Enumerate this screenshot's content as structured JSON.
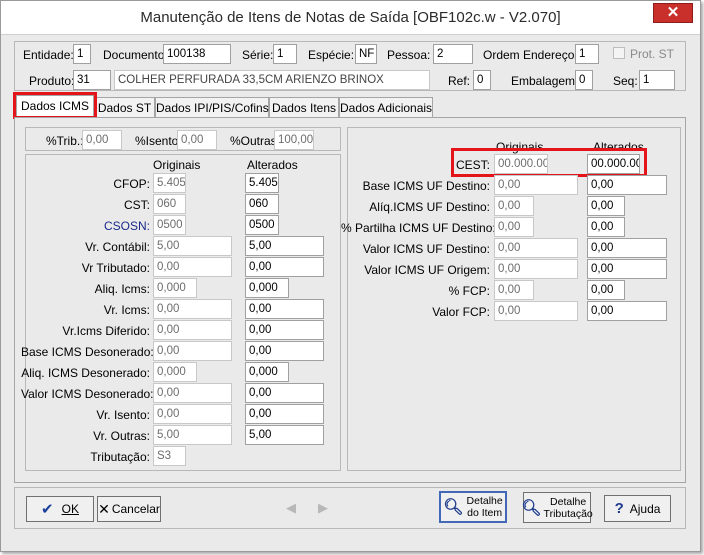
{
  "window": {
    "title": "Manutenção de Itens de Notas de Saída [OBF102c.w - V2.070]",
    "close": "✕"
  },
  "header": {
    "entidade_label": "Entidade:",
    "entidade": "1",
    "documento_label": "Documento:",
    "documento": "100138",
    "serie_label": "Série:",
    "serie": "1",
    "especie_label": "Espécie:",
    "especie": "NF",
    "pessoa_label": "Pessoa:",
    "pessoa": "2",
    "ordem_label": "Ordem Endereços:",
    "ordem": "1",
    "prot_label": "Prot. ST",
    "produto_label": "Produto:",
    "produto": "31",
    "produto_desc": "COLHER PERFURADA 33,5CM ARIENZO BRINOX",
    "ref_label": "Ref:",
    "ref": "0",
    "embalagem_label": "Embalagem:",
    "embalagem": "0",
    "seq_label": "Seq:",
    "seq": "1"
  },
  "tabs": [
    "Dados ICMS",
    "Dados ST",
    "Dados IPI/PIS/Cofins",
    "Dados Itens",
    "Dados Adicionais"
  ],
  "pct": {
    "trib_label": "%Trib.:",
    "trib": "0,00",
    "isento_label": "%Isento:",
    "isento": "0,00",
    "outras_label": "%Outras:",
    "outras": "100,00"
  },
  "left": {
    "originais": "Originais",
    "alterados": "Alterados",
    "rows": [
      {
        "label": "CFOP:",
        "orig": "5.405",
        "alt": "5.405"
      },
      {
        "label": "CST:",
        "orig": "060",
        "alt": "060"
      },
      {
        "label": "CSOSN:",
        "orig": "0500",
        "alt": "0500"
      },
      {
        "label": "Vr. Contábil:",
        "orig": "5,00",
        "alt": "5,00"
      },
      {
        "label": "Vr Tributado:",
        "orig": "0,00",
        "alt": "0,00"
      },
      {
        "label": "Aliq. Icms:",
        "orig": "0,000",
        "alt": "0,000"
      },
      {
        "label": "Vr. Icms:",
        "orig": "0,00",
        "alt": "0,00"
      },
      {
        "label": "Vr.Icms Diferido:",
        "orig": "0,00",
        "alt": "0,00"
      },
      {
        "label": "Base ICMS Desonerado:",
        "orig": "0,00",
        "alt": "0,00"
      },
      {
        "label": "Aliq. ICMS Desonerado:",
        "orig": "0,000",
        "alt": "0,000"
      },
      {
        "label": "Valor ICMS Desonerado:",
        "orig": "0,00",
        "alt": "0,00"
      },
      {
        "label": "Vr. Isento:",
        "orig": "0,00",
        "alt": "0,00"
      },
      {
        "label": "Vr. Outras:",
        "orig": "5,00",
        "alt": "5,00"
      }
    ],
    "tributacao_label": "Tributação:",
    "tributacao": "S3"
  },
  "right": {
    "originais": "Originais",
    "alterados": "Alterados",
    "rows": [
      {
        "label": "CEST:",
        "orig": "00.000.00",
        "alt": "00.000.00"
      },
      {
        "label": "Base ICMS UF Destino:",
        "orig": "0,00",
        "alt": "0,00"
      },
      {
        "label": "Alíq.ICMS UF Destino:",
        "orig": "0,00",
        "alt": "0,00"
      },
      {
        "label": "% Partilha ICMS UF Destino:",
        "orig": "0,00",
        "alt": "0,00"
      },
      {
        "label": "Valor ICMS UF Destino:",
        "orig": "0,00",
        "alt": "0,00"
      },
      {
        "label": "Valor ICMS UF Origem:",
        "orig": "0,00",
        "alt": "0,00"
      },
      {
        "label": "% FCP:",
        "orig": "0,00",
        "alt": "0,00"
      },
      {
        "label": "Valor FCP:",
        "orig": "0,00",
        "alt": "0,00"
      }
    ]
  },
  "buttons": {
    "ok": "OK",
    "cancelar": "Cancelar",
    "detalhe_item_1": "Detalhe",
    "detalhe_item_2": "do Item",
    "detalhe_trib_1": "Detalhe",
    "detalhe_trib_2": "Tributação",
    "ajuda": "Ajuda"
  },
  "colors": {
    "highlight": "#e3151a",
    "csosn_label": "#1a2a8a"
  }
}
